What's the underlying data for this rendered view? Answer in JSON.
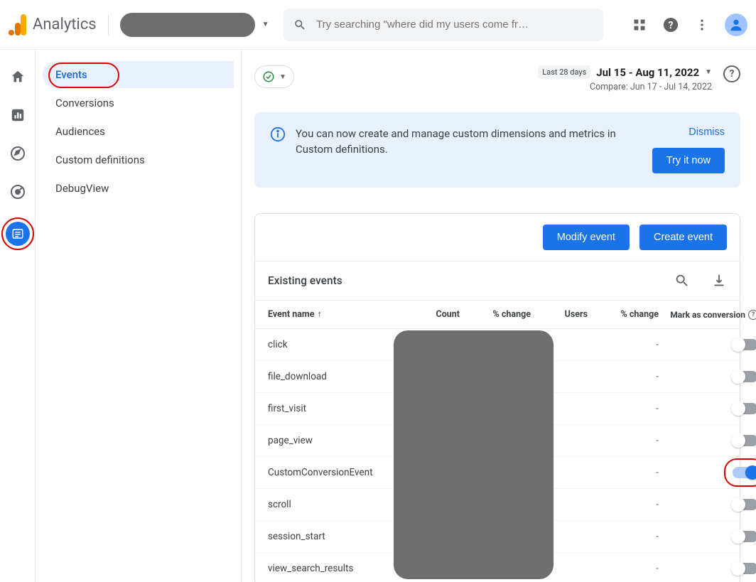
{
  "header": {
    "app_name": "Analytics",
    "search_placeholder": "Try searching \"where did my users come fr…"
  },
  "subnav": {
    "items": [
      {
        "label": "Events",
        "active": true
      },
      {
        "label": "Conversions"
      },
      {
        "label": "Audiences"
      },
      {
        "label": "Custom definitions"
      },
      {
        "label": "DebugView"
      }
    ]
  },
  "date": {
    "badge": "Last 28 days",
    "range": "Jul 15 - Aug 11, 2022",
    "compare": "Compare: Jun 17 - Jul 14, 2022"
  },
  "banner": {
    "message": "You can now create and manage custom dimensions and metrics in Custom definitions.",
    "dismiss": "Dismiss",
    "cta": "Try it now"
  },
  "eventsCard": {
    "modify_btn": "Modify event",
    "create_btn": "Create event",
    "title": "Existing events",
    "columns": {
      "name": "Event name",
      "count": "Count",
      "count_change": "% change",
      "users": "Users",
      "users_change": "% change",
      "conversion": "Mark as conversion"
    },
    "rows": [
      {
        "name": "click",
        "users_change": "-",
        "conversion": false
      },
      {
        "name": "file_download",
        "users_change": "-",
        "conversion": false
      },
      {
        "name": "first_visit",
        "users_change": "-",
        "conversion": false
      },
      {
        "name": "page_view",
        "users_change": "-",
        "conversion": false
      },
      {
        "name": "CustomConversionEvent",
        "users_change": "-",
        "conversion": true,
        "highlight": true
      },
      {
        "name": "scroll",
        "users_change": "-",
        "conversion": false
      },
      {
        "name": "session_start",
        "users_change": "-",
        "conversion": false
      },
      {
        "name": "view_search_results",
        "users_change": "-",
        "conversion": false
      }
    ]
  }
}
